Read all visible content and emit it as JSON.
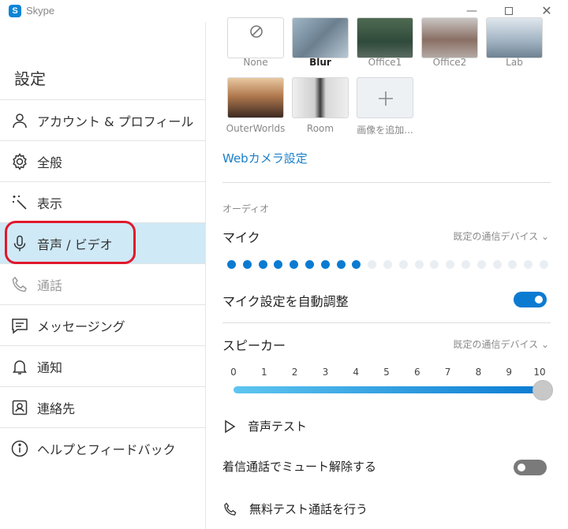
{
  "window": {
    "title": "Skype",
    "logo_letter": "S"
  },
  "sidebar": {
    "heading": "設定",
    "items": [
      {
        "label": "アカウント & プロフィール",
        "icon": "person-icon"
      },
      {
        "label": "全般",
        "icon": "gear-icon"
      },
      {
        "label": "表示",
        "icon": "magic-wand-icon"
      },
      {
        "label": "音声 / ビデオ",
        "icon": "microphone-icon",
        "selected": true
      },
      {
        "label": "通話",
        "icon": "phone-icon",
        "disabled": true
      },
      {
        "label": "メッセージング",
        "icon": "message-icon"
      },
      {
        "label": "通知",
        "icon": "bell-icon"
      },
      {
        "label": "連絡先",
        "icon": "contacts-icon"
      },
      {
        "label": "ヘルプとフィードバック",
        "icon": "info-icon"
      }
    ]
  },
  "backgrounds": {
    "items": [
      {
        "label": "None"
      },
      {
        "label": "Blur",
        "selected": true
      },
      {
        "label": "Office1"
      },
      {
        "label": "Office2"
      },
      {
        "label": "Lab"
      },
      {
        "label": "OuterWorlds"
      },
      {
        "label": "Room"
      },
      {
        "label": "画像を追加..."
      }
    ],
    "webcam_settings_link": "Webカメラ設定"
  },
  "audio": {
    "section_label": "オーディオ",
    "mic": {
      "label": "マイク",
      "device": "既定の通信デバイス",
      "level_active_dots": 9,
      "level_total_dots": 21,
      "auto_adjust_label": "マイク設定を自動調整",
      "auto_adjust_on": true
    },
    "speaker": {
      "label": "スピーカー",
      "device": "既定の通信デバイス",
      "ticks": [
        "0",
        "1",
        "2",
        "3",
        "4",
        "5",
        "6",
        "7",
        "8",
        "9",
        "10"
      ],
      "volume": 10
    },
    "sound_test_label": "音声テスト",
    "unmute_incoming_label": "着信通話でミュート解除する",
    "unmute_incoming_on": false,
    "free_test_call_label": "無料テスト通話を行う"
  },
  "colors": {
    "accent": "#0b7bd2",
    "selected_bg": "#cfe9f7",
    "highlight_ring": "#e0182b",
    "dot_inactive": "#e9eef3"
  }
}
